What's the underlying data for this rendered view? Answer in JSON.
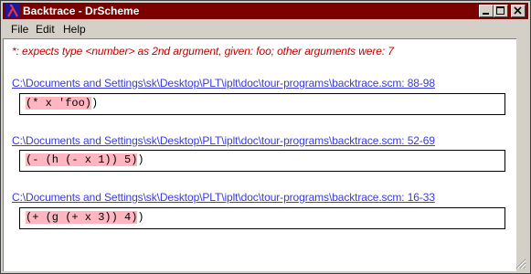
{
  "window": {
    "title": "Backtrace - DrScheme",
    "app_icon": "lambda-icon"
  },
  "menu": [
    "File",
    "Edit",
    "Help"
  ],
  "error_message": "*: expects type <number> as 2nd argument, given: foo; other arguments were: 7",
  "frames": [
    {
      "location": "C:\\Documents and Settings\\sk\\Desktop\\PLT\\iplt\\doc\\tour-programs\\backtrace.scm: 88-98",
      "code": "(* x 'foo)",
      "trailing": ")"
    },
    {
      "location": "C:\\Documents and Settings\\sk\\Desktop\\PLT\\iplt\\doc\\tour-programs\\backtrace.scm: 52-69",
      "code": "(- (h (- x 1)) 5)",
      "trailing": ")"
    },
    {
      "location": "C:\\Documents and Settings\\sk\\Desktop\\PLT\\iplt\\doc\\tour-programs\\backtrace.scm: 16-33",
      "code": "(+ (g (+ x 3)) 4)",
      "trailing": ")"
    }
  ],
  "colors": {
    "titlebar": "#7b0000",
    "error_text": "#c00000",
    "link": "#3a3adb",
    "highlight": "#ffb6c1"
  }
}
